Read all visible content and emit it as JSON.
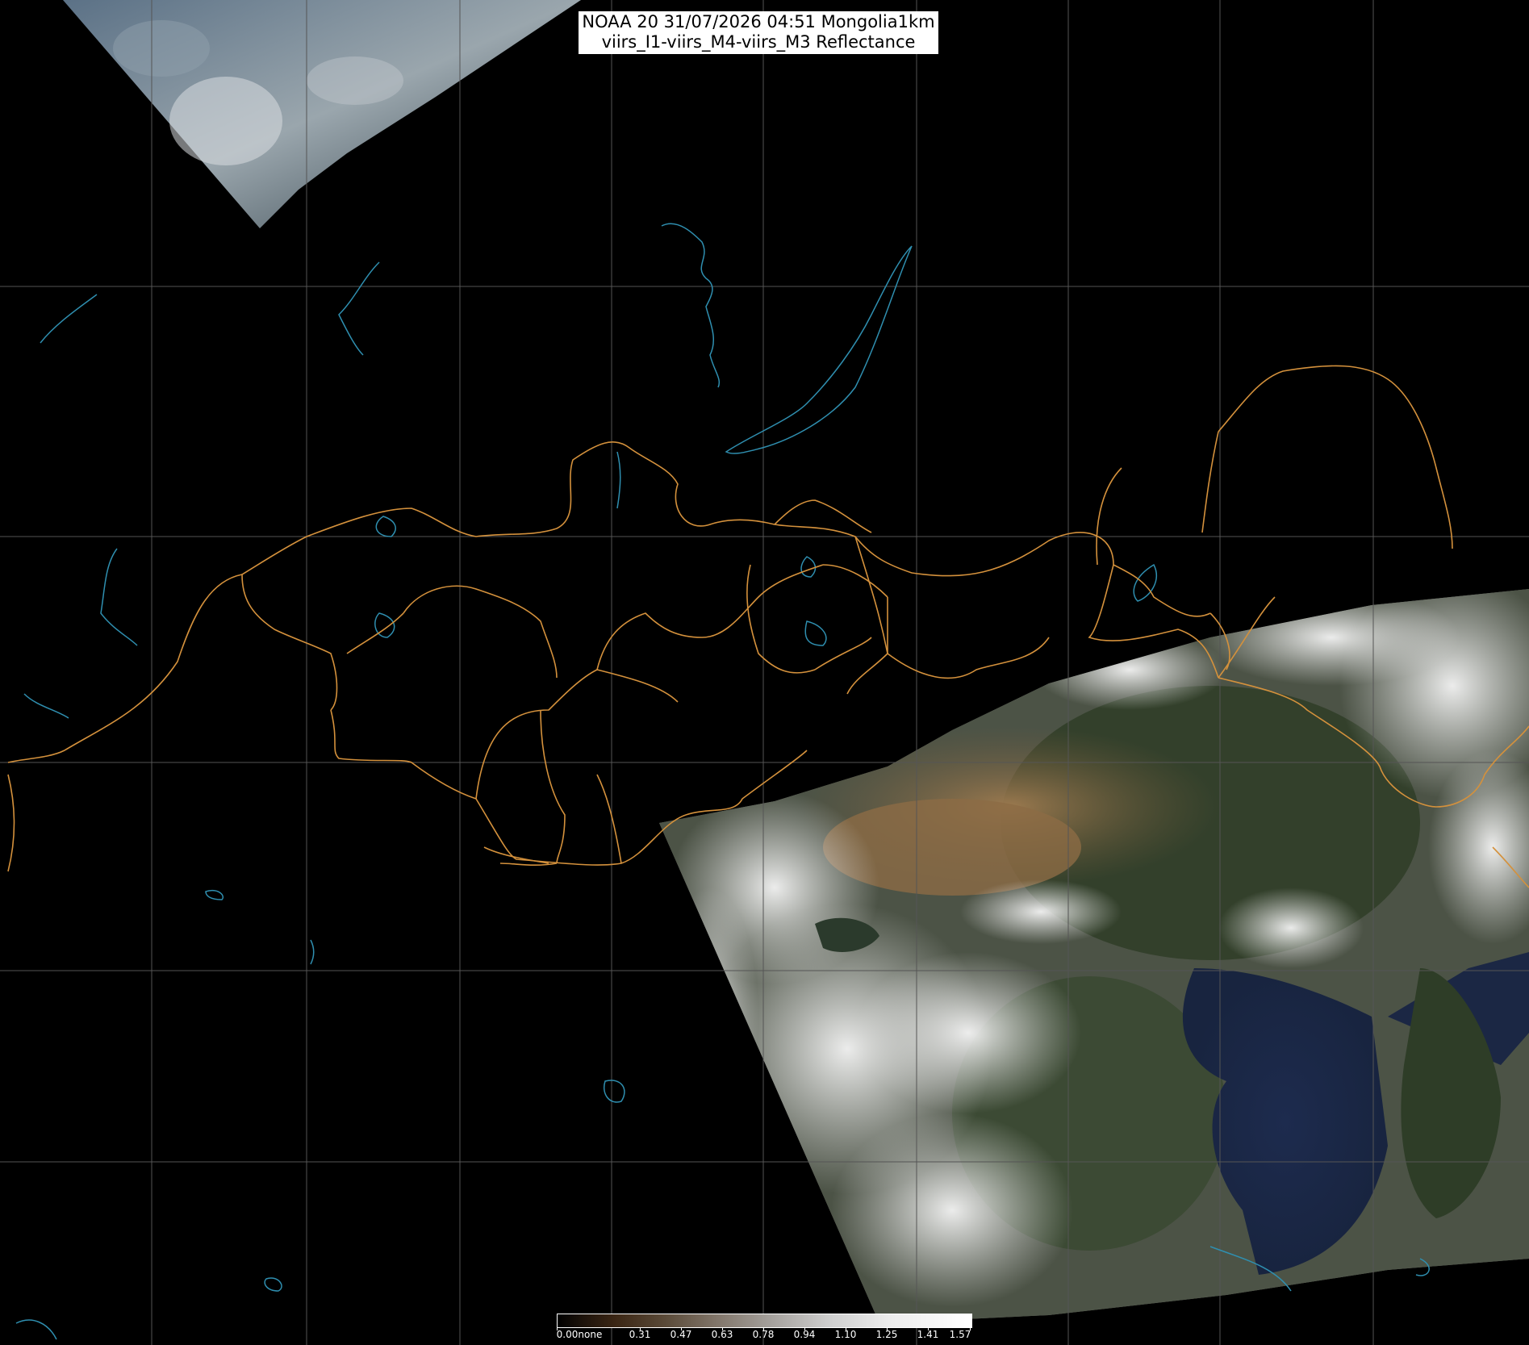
{
  "title": {
    "line1": "NOAA 20 31/07/2026 04:51 Mongolia1km",
    "line2": "viirs_I1-viirs_M4-viirs_M3 Reflectance"
  },
  "colors": {
    "background": "#000000",
    "grid": "#555555",
    "admin_border": "#d4913c",
    "coastline": "#2f8fb0",
    "cloud": "#e6e6e6",
    "desert": "#8a6a43",
    "forest": "#2e3a22",
    "sea": "#15203d"
  },
  "legend": {
    "labels": [
      "0.00none",
      "0.31",
      "0.47",
      "0.63",
      "0.78",
      "0.94",
      "1.10",
      "1.25",
      "1.41",
      "1.57"
    ]
  }
}
